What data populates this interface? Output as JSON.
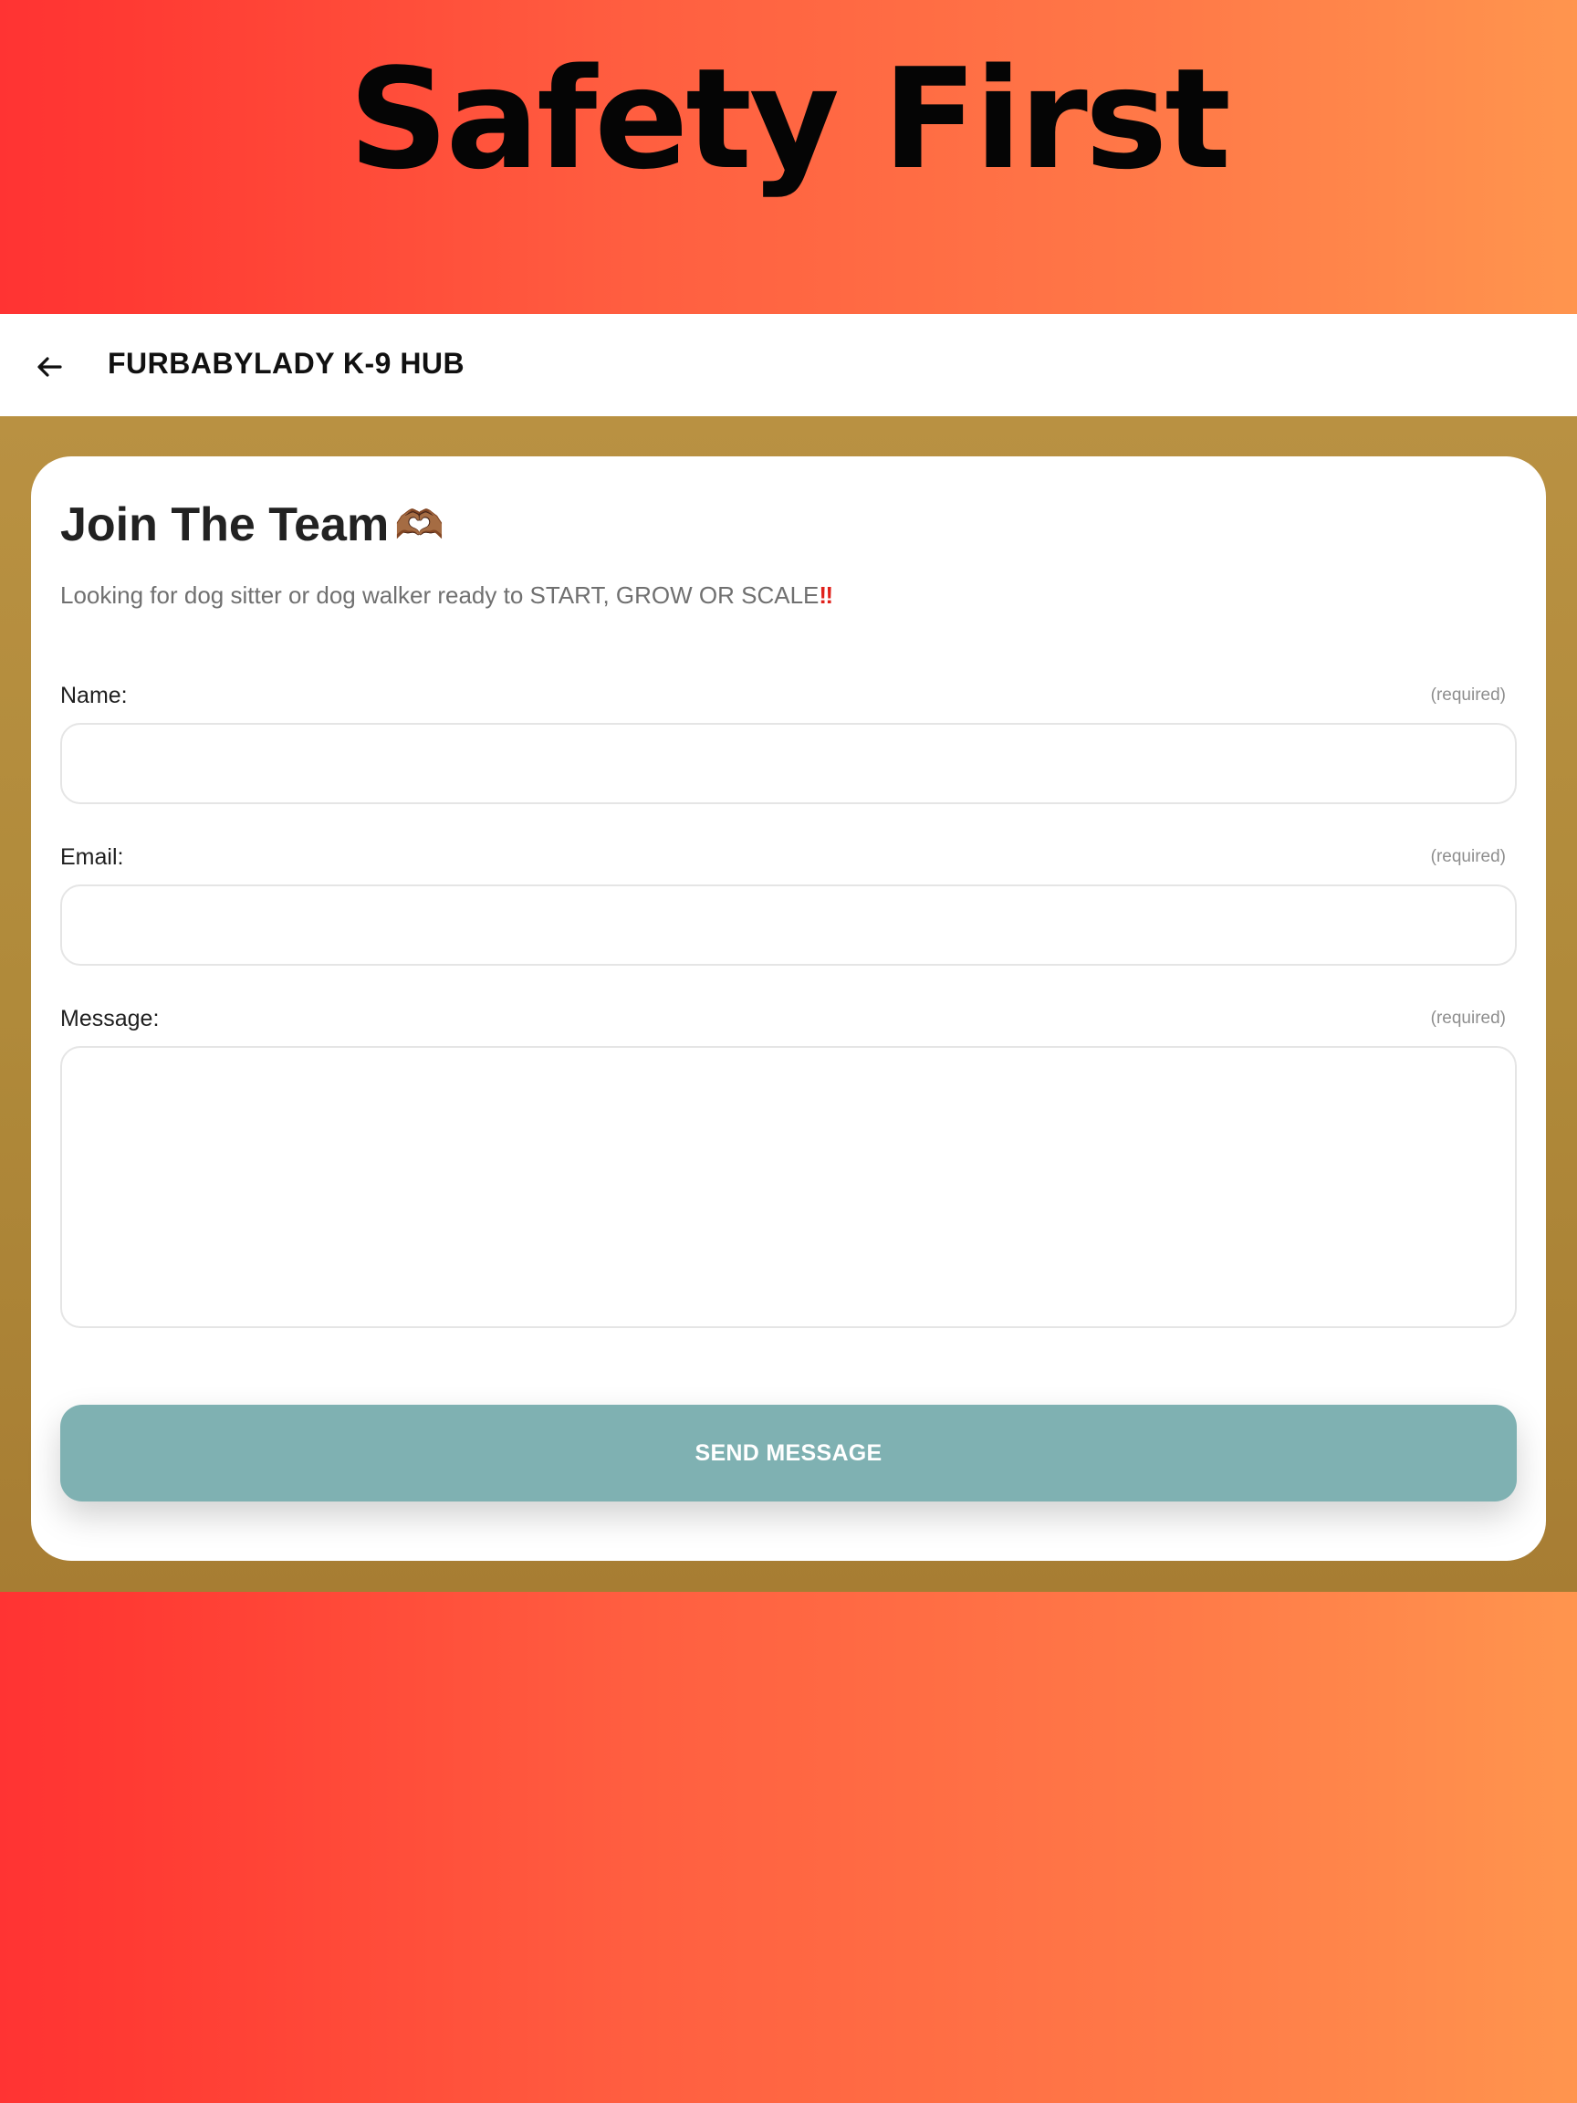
{
  "hero": {
    "title": "Safety First"
  },
  "header": {
    "back_icon": "arrow-left-icon",
    "site_name": "FURBABYLADY K-9 HUB"
  },
  "form": {
    "title": "Join The Team",
    "title_emoji": "🫶🏾",
    "subtitle": "Looking for dog sitter or dog walker ready to START, GROW OR SCALE",
    "subtitle_emoji": "‼",
    "fields": [
      {
        "label": "Name:",
        "required": "(required)",
        "value": ""
      },
      {
        "label": "Email:",
        "required": "(required)",
        "value": ""
      },
      {
        "label": "Message:",
        "required": "(required)",
        "value": ""
      }
    ],
    "submit_label": "SEND MESSAGE"
  },
  "colors": {
    "hero_gradient_start": "#ff3333",
    "hero_gradient_end": "#ff954e",
    "content_band": "#b08a3a",
    "button": "#7fb1b2"
  }
}
